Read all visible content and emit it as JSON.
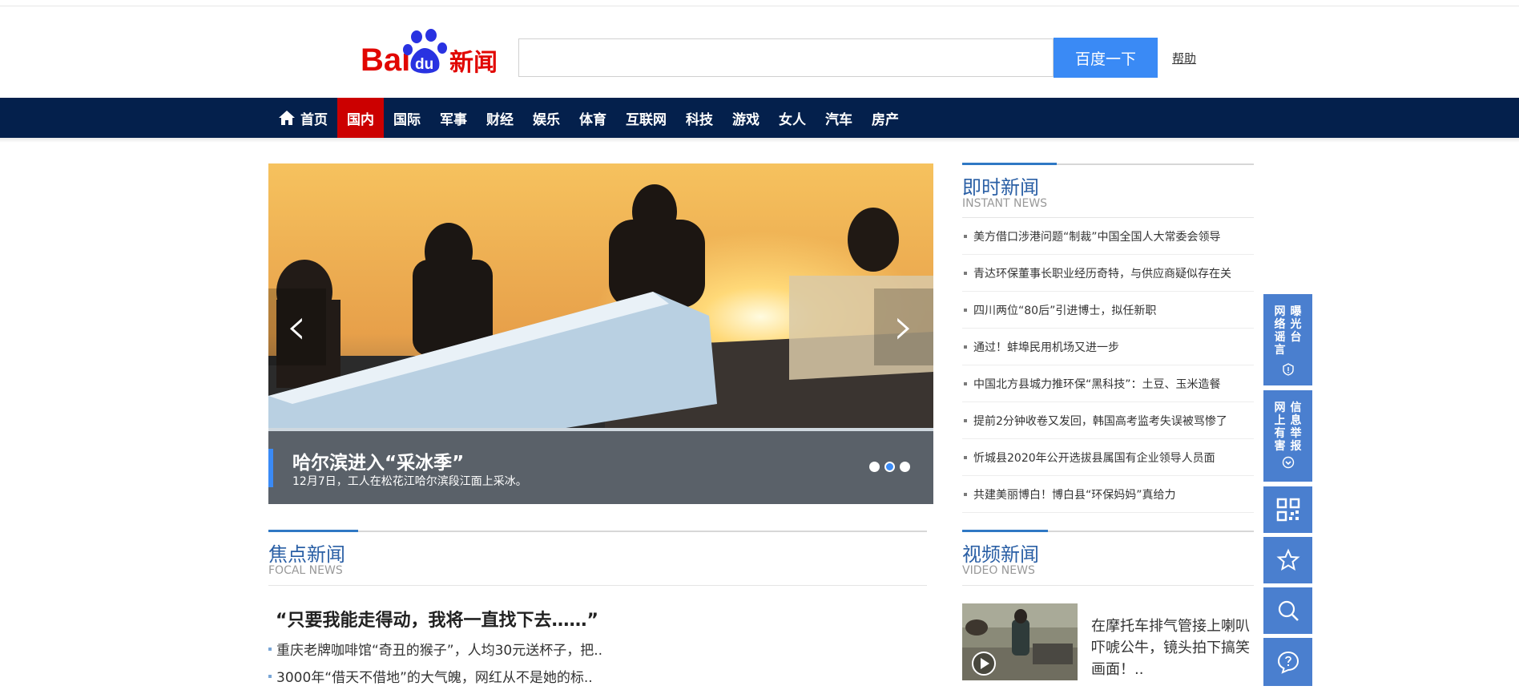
{
  "header": {
    "logo_text": "Bai du 新闻",
    "search": {
      "value": "",
      "placeholder": "",
      "button_label": "百度一下"
    },
    "help_label": "帮助"
  },
  "nav": {
    "items": [
      {
        "label": "首页",
        "icon": "home-icon"
      },
      {
        "label": "国内",
        "active": true
      },
      {
        "label": "国际"
      },
      {
        "label": "军事"
      },
      {
        "label": "财经"
      },
      {
        "label": "娱乐"
      },
      {
        "label": "体育"
      },
      {
        "label": "互联网"
      },
      {
        "label": "科技"
      },
      {
        "label": "游戏"
      },
      {
        "label": "女人"
      },
      {
        "label": "汽车"
      },
      {
        "label": "房产"
      }
    ]
  },
  "slider": {
    "title": "哈尔滨进入“采冰季”",
    "description": "12月7日，工人在松花江哈尔滨段江面上采冰。",
    "prev_icon": "chevron-left-icon",
    "next_icon": "chevron-right-icon",
    "slide_count": 3,
    "active_slide": 2
  },
  "instant_news": {
    "title": "即时新闻",
    "subtitle": "INSTANT NEWS",
    "items": [
      "美方借口涉港问题“制裁”中国全国人大常委会领导",
      "青达环保董事长职业经历奇特，与供应商疑似存在关",
      "四川两位“80后”引进博士，拟任新职",
      "通过！蚌埠民用机场又进一步",
      "中国北方县城力推环保“黑科技”：土豆、玉米造餐",
      "提前2分钟收卷又发回，韩国高考监考失误被骂惨了",
      "忻城县2020年公开选拔县属国有企业领导人员面",
      "共建美丽博白！博白县“环保妈妈”真给力"
    ]
  },
  "focal_news": {
    "title": "焦点新闻",
    "subtitle": "FOCAL NEWS",
    "headline": "“只要我能走得动，我将一直找下去……”",
    "items": [
      "重庆老牌咖啡馆“奇丑的猴子”，人均30元送杯子，把..",
      "3000年“借天不借地”的大气魄，网红从不是她的标.."
    ]
  },
  "video_news": {
    "title": "视频新闻",
    "subtitle": "VIDEO NEWS",
    "item_text": "在摩托车排气管接上喇叭吓唬公牛，镜头拍下搞笑画面！..",
    "play_icon": "play-icon"
  },
  "side_panel": {
    "exposure": {
      "left": "网络谣言",
      "right": "曝光台",
      "icon": "alert-icon"
    },
    "report": {
      "left": "网上有害",
      "right": "信息举报",
      "icon": "chevron-down-circle-icon"
    },
    "qr_icon": "qr-code-icon",
    "star_icon": "star-icon",
    "search_icon": "search-icon",
    "feedback_icon": "chat-question-icon"
  },
  "colors": {
    "nav_bg": "#04204c",
    "nav_active": "#cc0000",
    "accent_blue": "#3a8af5",
    "section_title": "#2a5fa5",
    "side_panel": "#4a7fcf"
  }
}
